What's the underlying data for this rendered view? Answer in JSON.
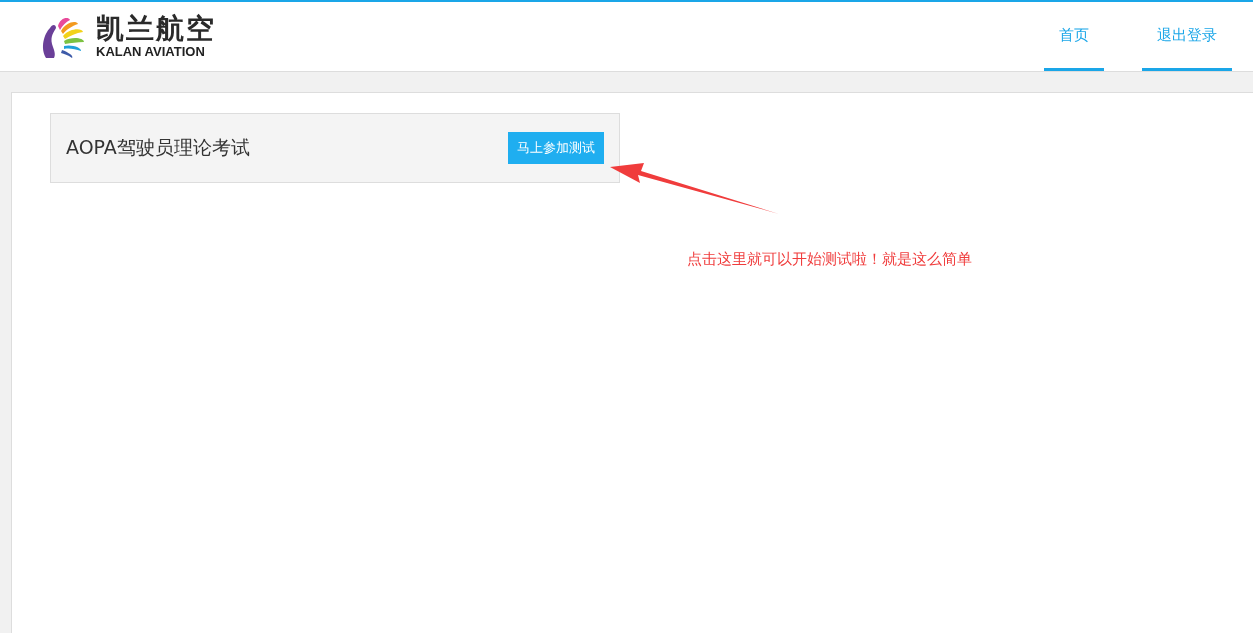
{
  "logo": {
    "name": "凯兰航空",
    "subtitle": "KALAN AVIATION"
  },
  "nav": [
    {
      "label": "首页",
      "selected": true
    },
    {
      "label": "退出登录",
      "selected": true
    }
  ],
  "exams": [
    {
      "title": "AOPA驾驶员理论考试",
      "button": "马上参加测试"
    }
  ],
  "annotation": {
    "text": "点击这里就可以开始测试啦！就是这么简单"
  }
}
